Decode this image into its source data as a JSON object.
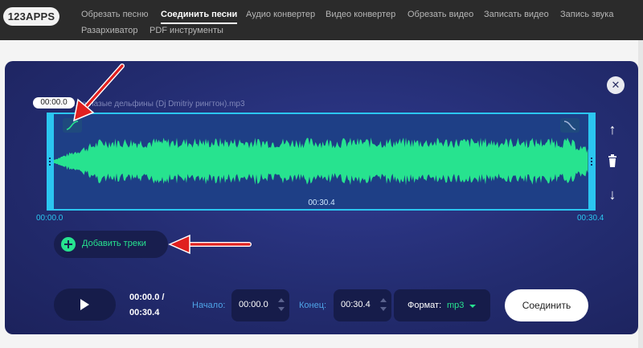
{
  "header": {
    "logo": "123APPS",
    "nav": [
      {
        "label": "Обрезать песню",
        "active": false
      },
      {
        "label": "Соединить песни",
        "active": true
      },
      {
        "label": "Аудио конвертер",
        "active": false
      },
      {
        "label": "Видео конвертер",
        "active": false
      },
      {
        "label": "Обрезать видео",
        "active": false
      },
      {
        "label": "Записать видео",
        "active": false
      },
      {
        "label": "Запись звука",
        "active": false
      },
      {
        "label": "Разархиватор",
        "active": false
      },
      {
        "label": "PDF инструменты",
        "active": false
      }
    ]
  },
  "editor": {
    "close_label": "✕",
    "tooltip_time": "00:00.0",
    "filename": "...неглазые дельфины (Dj Dmitriy рингтон).mp3",
    "track_duration": "00:30.4",
    "range_start": "00:00.0",
    "range_end": "00:30.4",
    "side_tools": {
      "move_up_label": "↑",
      "move_down_label": "↓"
    },
    "add_tracks_label": "Добавить треки",
    "waveform_color": "#27e38f",
    "accent_color": "#2bc6f0"
  },
  "controls": {
    "current_time": "00:00.0 /",
    "total_time": "00:30.4",
    "start_label": "Начало:",
    "start_value": "00:00.0",
    "end_label": "Конец:",
    "end_value": "00:30.4",
    "format_label": "Формат:",
    "format_value": "mp3",
    "join_label": "Соединить"
  }
}
